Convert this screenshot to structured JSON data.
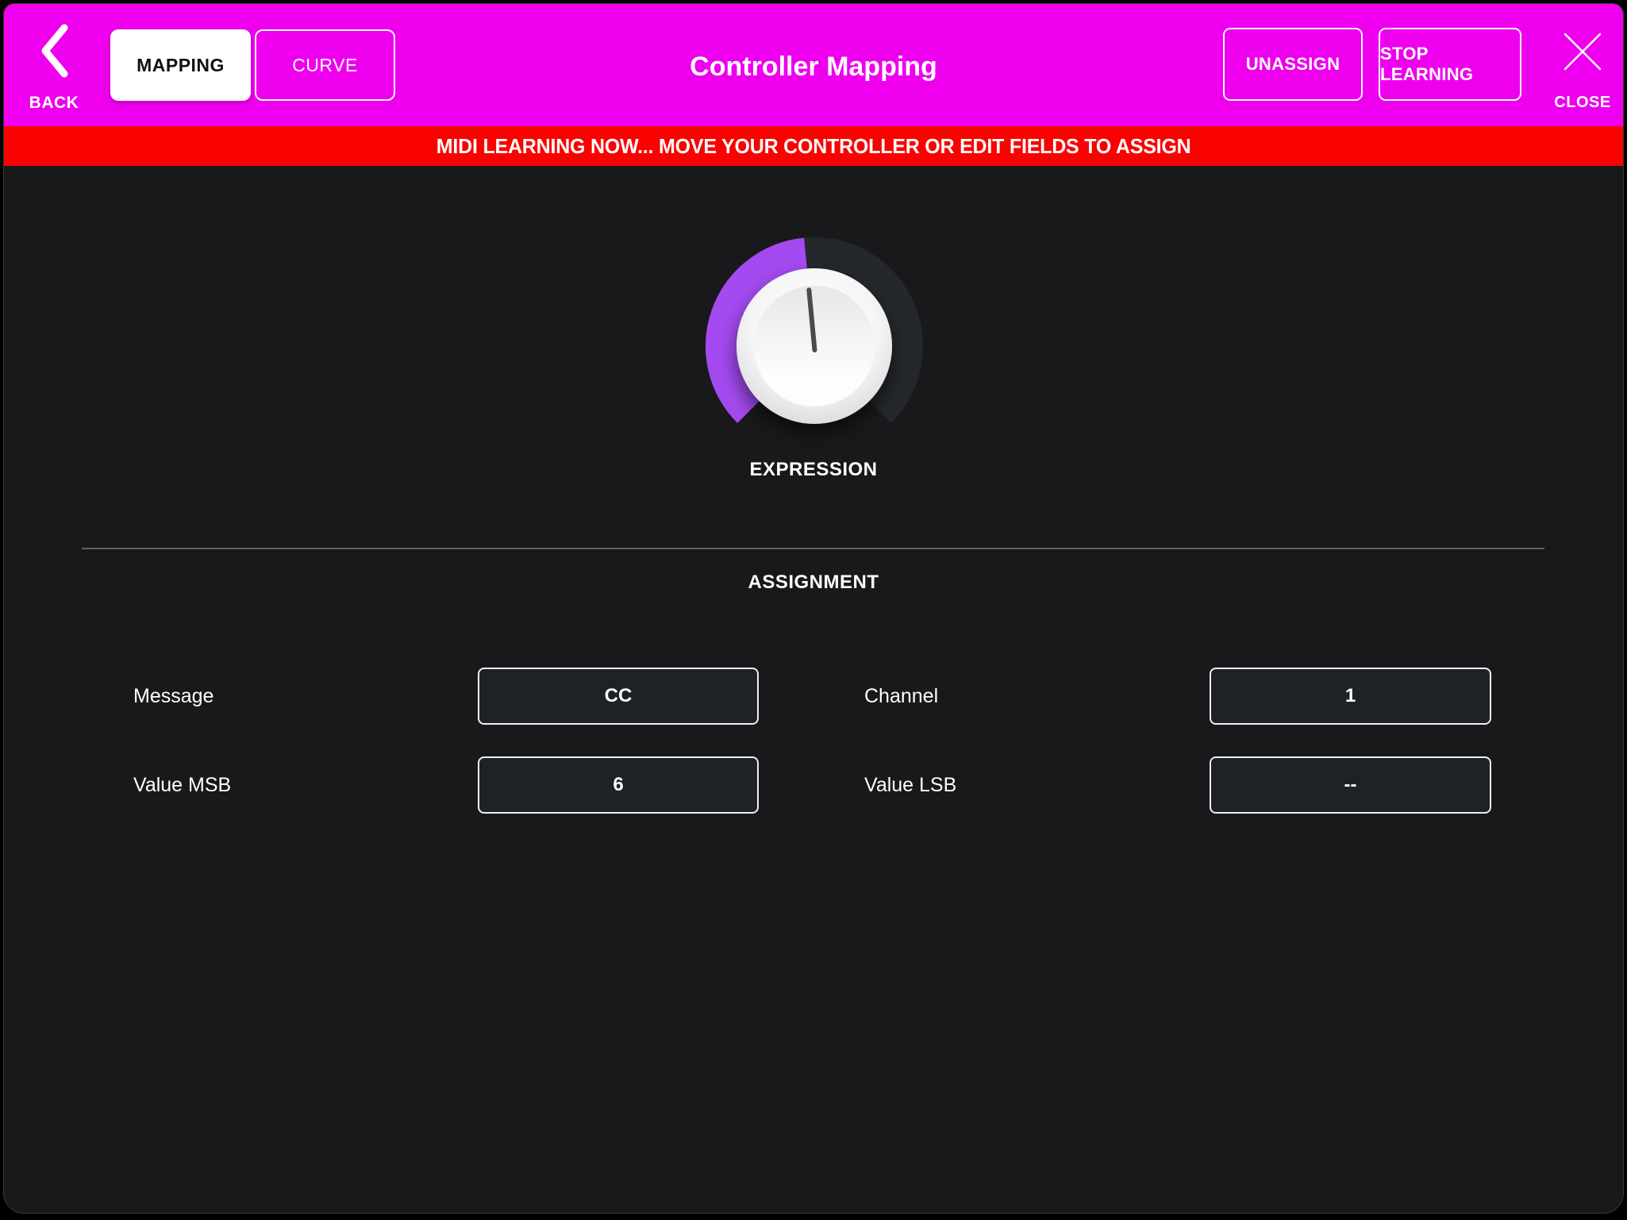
{
  "header": {
    "back_label": "BACK",
    "tabs": [
      {
        "label": "MAPPING",
        "active": true
      },
      {
        "label": "CURVE",
        "active": false
      }
    ],
    "title": "Controller Mapping",
    "unassign_label": "UNASSIGN",
    "stop_learning_label": "STOP LEARNING",
    "close_label": "CLOSE"
  },
  "banner": {
    "text": "MIDI LEARNING NOW... MOVE YOUR CONTROLLER OR EDIT FIELDS TO ASSIGN"
  },
  "knob": {
    "label": "EXPRESSION",
    "value_percent": 48,
    "arc_start_deg": 135,
    "arc_sweep_deg": 270
  },
  "assignment": {
    "title": "ASSIGNMENT",
    "fields": [
      {
        "label": "Message",
        "value": "CC"
      },
      {
        "label": "Channel",
        "value": "1"
      },
      {
        "label": "Value MSB",
        "value": "6"
      },
      {
        "label": "Value LSB",
        "value": "--"
      }
    ]
  },
  "icons": {
    "back": "chevron-left-icon",
    "close": "close-x-icon"
  },
  "colors": {
    "magenta": "#EE00EE",
    "red": "#FA0202",
    "purple": "#A44AF0",
    "track": "#24272C",
    "body-bg": "#19191B",
    "field-bg": "#1E2227",
    "field-border": "#EFEFEF"
  }
}
